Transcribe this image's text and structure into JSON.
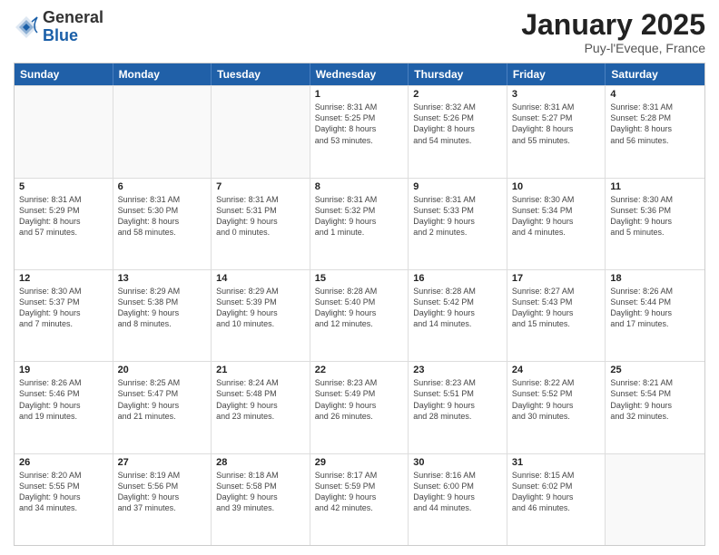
{
  "header": {
    "logo_general": "General",
    "logo_blue": "Blue",
    "month_year": "January 2025",
    "location": "Puy-l'Eveque, France"
  },
  "days_of_week": [
    "Sunday",
    "Monday",
    "Tuesday",
    "Wednesday",
    "Thursday",
    "Friday",
    "Saturday"
  ],
  "weeks": [
    [
      {
        "day": "",
        "content": ""
      },
      {
        "day": "",
        "content": ""
      },
      {
        "day": "",
        "content": ""
      },
      {
        "day": "1",
        "content": "Sunrise: 8:31 AM\nSunset: 5:25 PM\nDaylight: 8 hours\nand 53 minutes."
      },
      {
        "day": "2",
        "content": "Sunrise: 8:32 AM\nSunset: 5:26 PM\nDaylight: 8 hours\nand 54 minutes."
      },
      {
        "day": "3",
        "content": "Sunrise: 8:31 AM\nSunset: 5:27 PM\nDaylight: 8 hours\nand 55 minutes."
      },
      {
        "day": "4",
        "content": "Sunrise: 8:31 AM\nSunset: 5:28 PM\nDaylight: 8 hours\nand 56 minutes."
      }
    ],
    [
      {
        "day": "5",
        "content": "Sunrise: 8:31 AM\nSunset: 5:29 PM\nDaylight: 8 hours\nand 57 minutes."
      },
      {
        "day": "6",
        "content": "Sunrise: 8:31 AM\nSunset: 5:30 PM\nDaylight: 8 hours\nand 58 minutes."
      },
      {
        "day": "7",
        "content": "Sunrise: 8:31 AM\nSunset: 5:31 PM\nDaylight: 9 hours\nand 0 minutes."
      },
      {
        "day": "8",
        "content": "Sunrise: 8:31 AM\nSunset: 5:32 PM\nDaylight: 9 hours\nand 1 minute."
      },
      {
        "day": "9",
        "content": "Sunrise: 8:31 AM\nSunset: 5:33 PM\nDaylight: 9 hours\nand 2 minutes."
      },
      {
        "day": "10",
        "content": "Sunrise: 8:30 AM\nSunset: 5:34 PM\nDaylight: 9 hours\nand 4 minutes."
      },
      {
        "day": "11",
        "content": "Sunrise: 8:30 AM\nSunset: 5:36 PM\nDaylight: 9 hours\nand 5 minutes."
      }
    ],
    [
      {
        "day": "12",
        "content": "Sunrise: 8:30 AM\nSunset: 5:37 PM\nDaylight: 9 hours\nand 7 minutes."
      },
      {
        "day": "13",
        "content": "Sunrise: 8:29 AM\nSunset: 5:38 PM\nDaylight: 9 hours\nand 8 minutes."
      },
      {
        "day": "14",
        "content": "Sunrise: 8:29 AM\nSunset: 5:39 PM\nDaylight: 9 hours\nand 10 minutes."
      },
      {
        "day": "15",
        "content": "Sunrise: 8:28 AM\nSunset: 5:40 PM\nDaylight: 9 hours\nand 12 minutes."
      },
      {
        "day": "16",
        "content": "Sunrise: 8:28 AM\nSunset: 5:42 PM\nDaylight: 9 hours\nand 14 minutes."
      },
      {
        "day": "17",
        "content": "Sunrise: 8:27 AM\nSunset: 5:43 PM\nDaylight: 9 hours\nand 15 minutes."
      },
      {
        "day": "18",
        "content": "Sunrise: 8:26 AM\nSunset: 5:44 PM\nDaylight: 9 hours\nand 17 minutes."
      }
    ],
    [
      {
        "day": "19",
        "content": "Sunrise: 8:26 AM\nSunset: 5:46 PM\nDaylight: 9 hours\nand 19 minutes."
      },
      {
        "day": "20",
        "content": "Sunrise: 8:25 AM\nSunset: 5:47 PM\nDaylight: 9 hours\nand 21 minutes."
      },
      {
        "day": "21",
        "content": "Sunrise: 8:24 AM\nSunset: 5:48 PM\nDaylight: 9 hours\nand 23 minutes."
      },
      {
        "day": "22",
        "content": "Sunrise: 8:23 AM\nSunset: 5:49 PM\nDaylight: 9 hours\nand 26 minutes."
      },
      {
        "day": "23",
        "content": "Sunrise: 8:23 AM\nSunset: 5:51 PM\nDaylight: 9 hours\nand 28 minutes."
      },
      {
        "day": "24",
        "content": "Sunrise: 8:22 AM\nSunset: 5:52 PM\nDaylight: 9 hours\nand 30 minutes."
      },
      {
        "day": "25",
        "content": "Sunrise: 8:21 AM\nSunset: 5:54 PM\nDaylight: 9 hours\nand 32 minutes."
      }
    ],
    [
      {
        "day": "26",
        "content": "Sunrise: 8:20 AM\nSunset: 5:55 PM\nDaylight: 9 hours\nand 34 minutes."
      },
      {
        "day": "27",
        "content": "Sunrise: 8:19 AM\nSunset: 5:56 PM\nDaylight: 9 hours\nand 37 minutes."
      },
      {
        "day": "28",
        "content": "Sunrise: 8:18 AM\nSunset: 5:58 PM\nDaylight: 9 hours\nand 39 minutes."
      },
      {
        "day": "29",
        "content": "Sunrise: 8:17 AM\nSunset: 5:59 PM\nDaylight: 9 hours\nand 42 minutes."
      },
      {
        "day": "30",
        "content": "Sunrise: 8:16 AM\nSunset: 6:00 PM\nDaylight: 9 hours\nand 44 minutes."
      },
      {
        "day": "31",
        "content": "Sunrise: 8:15 AM\nSunset: 6:02 PM\nDaylight: 9 hours\nand 46 minutes."
      },
      {
        "day": "",
        "content": ""
      }
    ]
  ]
}
